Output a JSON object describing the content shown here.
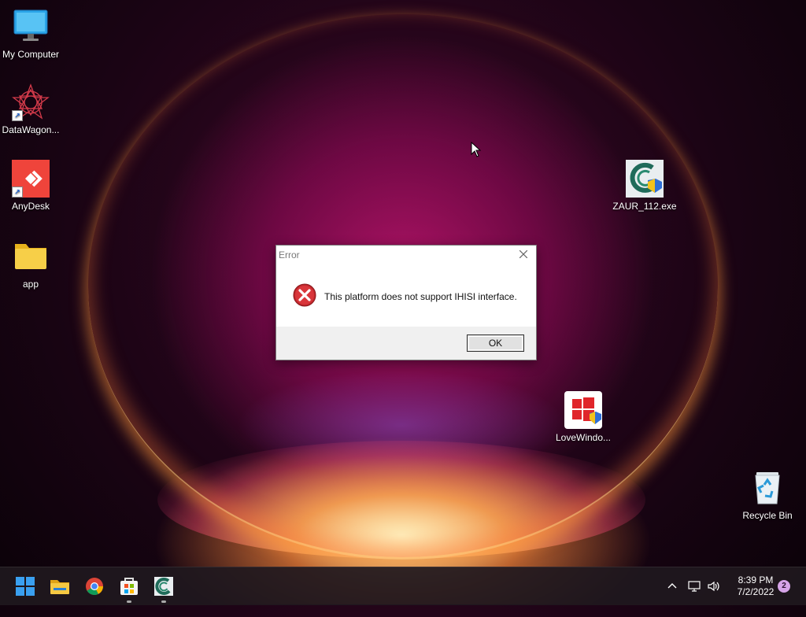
{
  "desktop": {
    "icons": [
      {
        "label": "My Computer",
        "icon": "monitor-icon"
      },
      {
        "label": "DataWagon...",
        "icon": "datawagon-icon"
      },
      {
        "label": "AnyDesk",
        "icon": "anydesk-icon"
      },
      {
        "label": "app",
        "icon": "folder-icon"
      },
      {
        "label": "ZAUR_112.exe",
        "icon": "zaur-exe-icon"
      },
      {
        "label": "LoveWindo...",
        "icon": "lovewindows-icon"
      },
      {
        "label": "Recycle Bin",
        "icon": "recycle-bin-icon"
      }
    ]
  },
  "dialog": {
    "title": "Error",
    "message": "This platform does not support IHISI interface.",
    "ok_label": "OK",
    "icon": "error-icon",
    "close_icon": "close-icon"
  },
  "taskbar": {
    "items": [
      "start-icon",
      "file-explorer-icon",
      "chrome-icon",
      "store-icon",
      "zaur-app-icon"
    ],
    "tray": {
      "time": "8:39 PM",
      "date": "7/2/2022",
      "notification_count": "2"
    }
  },
  "colors": {
    "taskbar_bg": "#20181e",
    "dialog_bg": "#ffffff",
    "dialog_footer": "#f0f0f0",
    "error_red": "#c0282d"
  }
}
